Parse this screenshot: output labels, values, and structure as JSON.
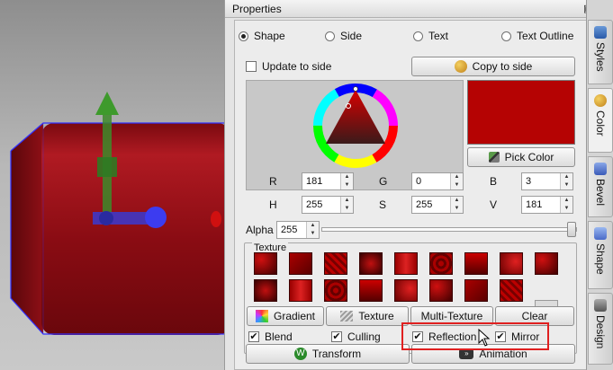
{
  "panel": {
    "title": "Properties",
    "pin_icon": "pin-icon",
    "close_icon": "close-icon"
  },
  "radios": [
    {
      "label": "Shape",
      "checked": true
    },
    {
      "label": "Side",
      "checked": false
    },
    {
      "label": "Text",
      "checked": false
    },
    {
      "label": "Text Outline",
      "checked": false
    }
  ],
  "update_to_side": {
    "label": "Update to side",
    "checked": false
  },
  "copy_to_side": {
    "label": "Copy to side",
    "icon": "palette-icon"
  },
  "pick_color": {
    "label": "Pick Color",
    "icon": "eyedropper-icon"
  },
  "current_color": "#b50303",
  "rgb": {
    "r_label": "R",
    "r_value": "181",
    "g_label": "G",
    "g_value": "0",
    "b_label": "B",
    "b_value": "3"
  },
  "hsv": {
    "h_label": "H",
    "h_value": "255",
    "s_label": "S",
    "s_value": "255",
    "v_label": "V",
    "v_value": "181"
  },
  "alpha": {
    "label": "Alpha",
    "value": "255",
    "level": 1.0
  },
  "texture": {
    "legend": "Texture",
    "more_icon": "dropdown-arrow-icon"
  },
  "buttons": {
    "gradient": "Gradient",
    "texture": "Texture",
    "multi_texture": "Multi-Texture",
    "clear": "Clear",
    "transform": "Transform",
    "animation": "Animation"
  },
  "checks": {
    "blend": {
      "label": "Blend",
      "checked": true
    },
    "culling": {
      "label": "Culling",
      "checked": true
    },
    "reflection": {
      "label": "Reflection",
      "checked": true
    },
    "mirror": {
      "label": "Mirror",
      "checked": true
    }
  },
  "side_tabs": [
    {
      "label": "Styles",
      "icon": "styles-icon"
    },
    {
      "label": "Color",
      "icon": "color-icon",
      "active": true
    },
    {
      "label": "Bevel",
      "icon": "bevel-icon"
    },
    {
      "label": "Shape",
      "icon": "shape-icon"
    },
    {
      "label": "Design",
      "icon": "design-icon"
    }
  ]
}
